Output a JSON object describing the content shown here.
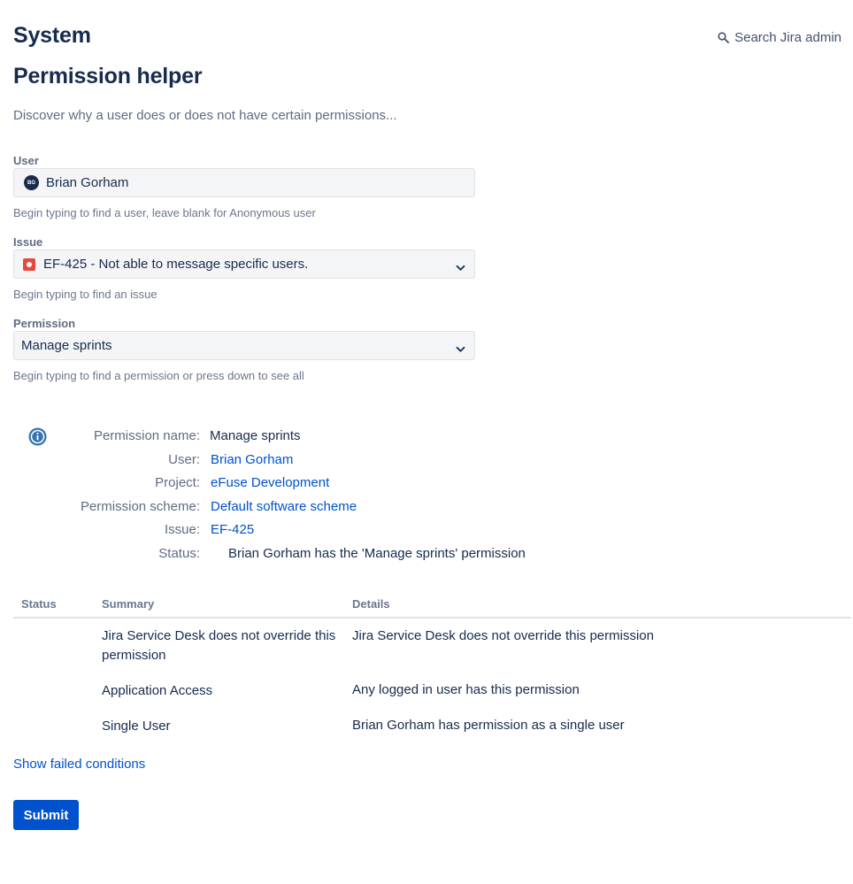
{
  "header": {
    "title": "System",
    "search_label": "Search Jira admin",
    "search_icon": "search-icon"
  },
  "page": {
    "title": "Permission helper",
    "description": "Discover why a user does or does not have certain permissions..."
  },
  "form": {
    "user": {
      "label": "User",
      "value": "Brian Gorham",
      "avatar_initials": "BG",
      "help": "Begin typing to find a user, leave blank for Anonymous user"
    },
    "issue": {
      "label": "Issue",
      "value": "EF-425 - Not able to message specific users.",
      "icon": "bug-icon",
      "help": "Begin typing to find an issue"
    },
    "permission": {
      "label": "Permission",
      "value": "Manage sprints",
      "help": "Begin typing to find a permission or press down to see all"
    }
  },
  "result": {
    "icon": "info-icon",
    "rows": [
      {
        "label": "Permission name:",
        "value": "Manage sprints"
      },
      {
        "label": "User:",
        "value": "Brian Gorham"
      },
      {
        "label": "Project:",
        "value": "eFuse Development"
      },
      {
        "label": "Permission scheme:",
        "value": "Default software scheme"
      },
      {
        "label": "Issue:",
        "value": "EF-425"
      },
      {
        "label": "Status:",
        "value": "Brian Gorham has the 'Manage sprints' permission"
      }
    ]
  },
  "table": {
    "headers": [
      "Status",
      "Summary",
      "Details"
    ],
    "rows": [
      {
        "status": "",
        "summary_line1": "Jira Service Desk does not override this",
        "summary_line2": "permission",
        "details": "Jira Service Desk does not override this permission"
      },
      {
        "status": "",
        "summary_line1": "Application Access",
        "summary_line2": "",
        "details": "Any logged in user has this permission"
      },
      {
        "status": "",
        "summary_line1": "Single User",
        "summary_line2": "",
        "details": "Brian Gorham has permission as a single user"
      }
    ]
  },
  "actions": {
    "show_failed": "Show failed conditions",
    "submit": "Submit"
  },
  "colors": {
    "primary": "#0052cc",
    "text": "#172b4d",
    "subtle": "#5e6c84",
    "bug": "#e5493a"
  }
}
